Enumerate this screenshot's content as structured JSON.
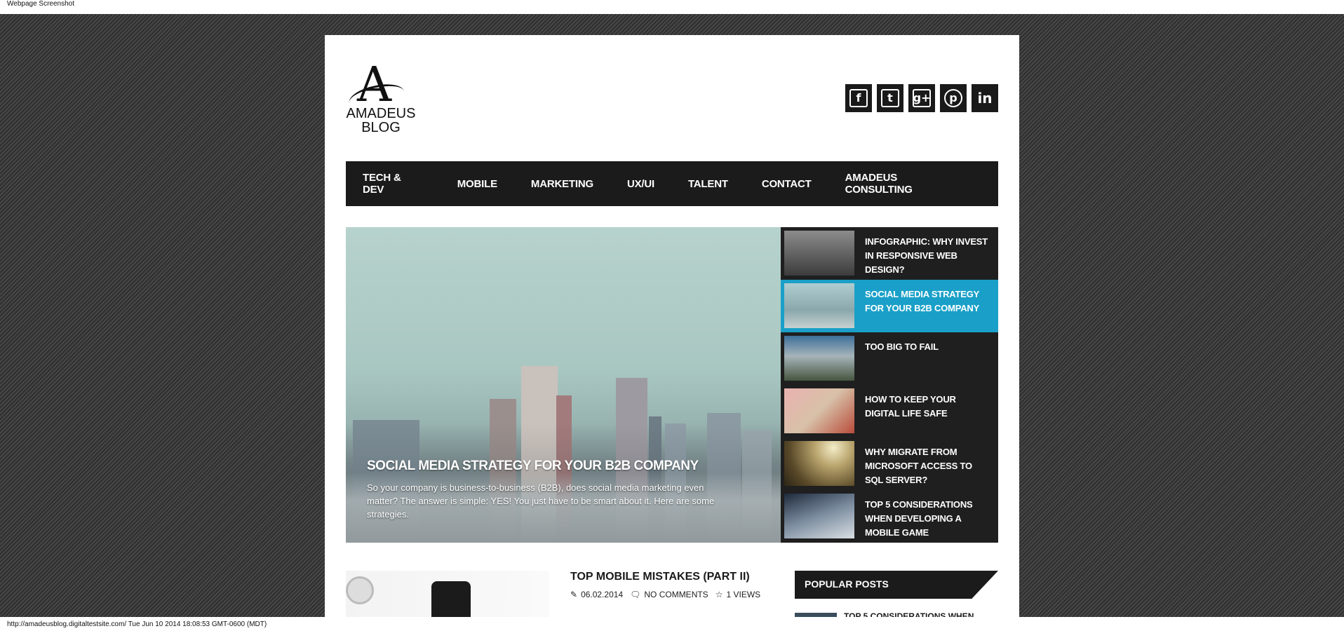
{
  "browser": {
    "header_label": "Webpage Screenshot",
    "status_line": "http://amadeusblog.digitaltestsite.com/ Tue Jun 10 2014 18:08:53 GMT-0600 (MDT)"
  },
  "logo": {
    "glyph": "A",
    "line1": "AMADEUS",
    "line2": "BLOG"
  },
  "social": [
    {
      "name": "facebook-icon",
      "glyph": "f"
    },
    {
      "name": "twitter-icon",
      "glyph": "t"
    },
    {
      "name": "google-plus-icon",
      "glyph": "g+"
    },
    {
      "name": "pinterest-icon",
      "glyph": "p"
    },
    {
      "name": "linkedin-icon",
      "glyph": "in"
    }
  ],
  "nav": {
    "items": [
      "TECH & DEV",
      "MOBILE",
      "MARKETING",
      "UX/UI",
      "TALENT",
      "CONTACT",
      "AMADEUS CONSULTING"
    ]
  },
  "hero": {
    "title": "SOCIAL MEDIA STRATEGY FOR YOUR B2B COMPANY",
    "excerpt": "So your company is business-to-business (B2B), does social media marketing even matter? The answer is simple: YES! You just have to be smart about it. Here are some strategies."
  },
  "side_posts": [
    {
      "title": "INFOGRAPHIC: WHY INVEST IN RESPONSIVE WEB DESIGN?",
      "active": false
    },
    {
      "title": "SOCIAL MEDIA STRATEGY FOR YOUR B2B COMPANY",
      "active": true
    },
    {
      "title": "TOO BIG TO FAIL",
      "active": false
    },
    {
      "title": "HOW TO KEEP YOUR DIGITAL LIFE SAFE",
      "active": false
    },
    {
      "title": "WHY MIGRATE FROM MICROSOFT ACCESS TO SQL SERVER?",
      "active": false
    },
    {
      "title": "TOP 5 CONSIDERATIONS WHEN DEVELOPING A MOBILE GAME",
      "active": false
    }
  ],
  "post": {
    "title": "TOP MOBILE MISTAKES (PART II)",
    "date": "06.02.2014",
    "comments": "NO COMMENTS",
    "views": "1 VIEWS"
  },
  "popular": {
    "heading": "POPULAR POSTS",
    "first_title": "TOP 5 CONSIDERATIONS WHEN"
  },
  "colors": {
    "accent": "#1aa0c8",
    "dark": "#1b1b1b"
  }
}
